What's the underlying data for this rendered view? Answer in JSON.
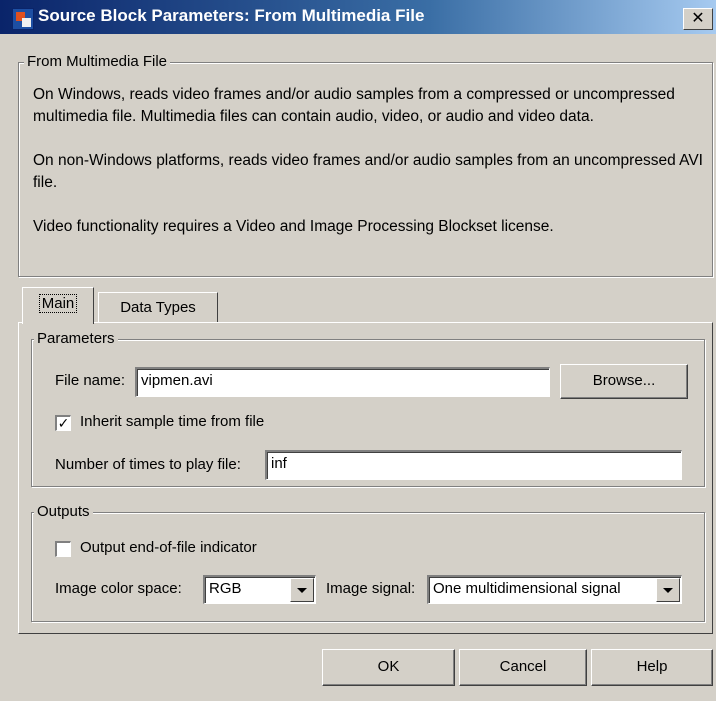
{
  "window": {
    "title": "Source Block Parameters: From Multimedia File",
    "close_glyph": "✕"
  },
  "description": {
    "legend": "From Multimedia File",
    "paragraphs": [
      "On Windows, reads video frames and/or audio samples from a compressed or uncompressed multimedia file. Multimedia files can contain audio, video, or audio and video data.",
      "On non-Windows platforms, reads video frames and/or audio samples from an uncompressed AVI file.",
      "Video functionality requires a Video and Image Processing Blockset license."
    ]
  },
  "tabs": [
    {
      "label": "Main",
      "active": true
    },
    {
      "label": "Data Types",
      "active": false
    }
  ],
  "parameters": {
    "legend": "Parameters",
    "file_name_label": "File name:",
    "file_name_value": "vipmen.avi",
    "browse_label": "Browse...",
    "inherit_label": "Inherit sample time from file",
    "inherit_checked": true,
    "play_times_label": "Number of times to play file:",
    "play_times_value": "inf"
  },
  "outputs": {
    "legend": "Outputs",
    "eof_label": "Output end-of-file indicator",
    "eof_checked": false,
    "color_space_label": "Image color space:",
    "color_space_value": "RGB",
    "signal_label": "Image signal:",
    "signal_value": "One multidimensional signal"
  },
  "buttons": {
    "ok": "OK",
    "cancel": "Cancel",
    "help": "Help"
  },
  "check_glyph": "✓",
  "icons": {
    "app": "simulink-block-icon",
    "close": "close-icon",
    "dropdown": "chevron-down-icon"
  }
}
